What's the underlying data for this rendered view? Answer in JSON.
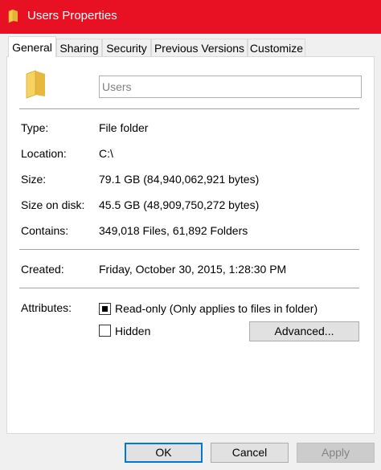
{
  "window": {
    "title": "Users Properties"
  },
  "tabs": [
    {
      "label": "General",
      "active": true
    },
    {
      "label": "Sharing",
      "active": false
    },
    {
      "label": "Security",
      "active": false
    },
    {
      "label": "Previous Versions",
      "active": false
    },
    {
      "label": "Customize",
      "active": false
    }
  ],
  "general": {
    "name_placeholder": "Users",
    "rows": [
      {
        "label": "Type:",
        "value": "File folder"
      },
      {
        "label": "Location:",
        "value": "C:\\"
      },
      {
        "label": "Size:",
        "value": "79.1 GB (84,940,062,921 bytes)"
      },
      {
        "label": "Size on disk:",
        "value": "45.5 GB (48,909,750,272 bytes)"
      },
      {
        "label": "Contains:",
        "value": "349,018 Files, 61,892 Folders"
      }
    ],
    "created_label": "Created:",
    "created_value": "Friday, October 30, 2015, 1:28:30 PM",
    "attributes_label": "Attributes:",
    "readonly_label": "Read-only (Only applies to files in folder)",
    "readonly_state": "indeterminate",
    "hidden_label": "Hidden",
    "hidden_checked": false,
    "advanced_button": "Advanced..."
  },
  "buttons": {
    "ok": "OK",
    "cancel": "Cancel",
    "apply": "Apply"
  },
  "colors": {
    "titlebar": "#e81123",
    "folder": "#f4c94c",
    "default_button_border": "#0078d7"
  }
}
